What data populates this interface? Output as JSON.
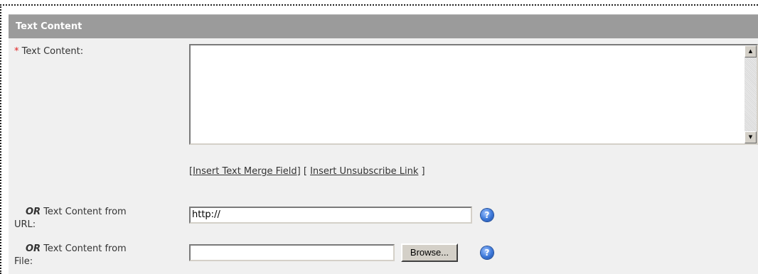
{
  "section": {
    "title": "Text Content"
  },
  "text_content": {
    "required_marker": "*",
    "label": "Text Content:",
    "value": ""
  },
  "links": {
    "open1": "[",
    "insert_merge_field": "Insert Text Merge Field",
    "mid": "] [",
    "insert_unsubscribe": "Insert Unsubscribe Link",
    "close": "]"
  },
  "url_field": {
    "or_label": "OR",
    "label_line1": "Text Content from",
    "label_line2": "URL:",
    "value": "http://"
  },
  "file_field": {
    "or_label": "OR",
    "label_line1": "Text Content from",
    "label_line2": "File:",
    "value": "",
    "browse_label": "Browse..."
  },
  "icons": {
    "help": "help-icon",
    "help_glyph": "?",
    "scroll_up": "▲",
    "scroll_down": "▼"
  }
}
